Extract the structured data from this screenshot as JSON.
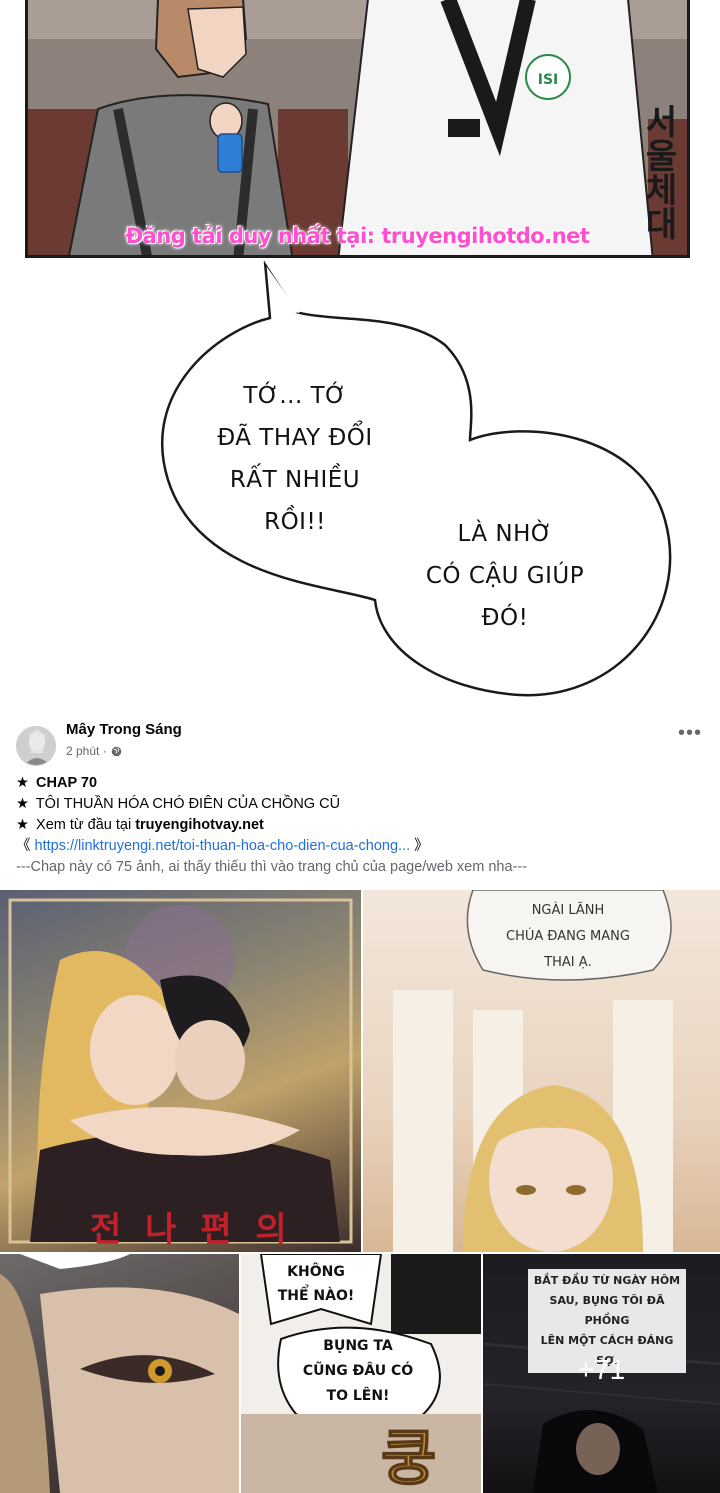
{
  "comic": {
    "watermark": "Đăng tải duy nhất tại: truyengihotdo.net",
    "jacket_text": "서울체대",
    "badge_text": "ISI",
    "bubble1_lines": [
      "TỚ... TỚ",
      "ĐÃ THAY ĐỔI",
      "RẤT NHIỀU",
      "RỒI!!"
    ],
    "bubble2_lines": [
      "LÀ NHỜ",
      "CÓ CẬU GIÚP",
      "ĐÓ!"
    ]
  },
  "post": {
    "author": "Mây Trong Sáng",
    "time": "2 phút ·",
    "more_icon": "ellipsis-icon",
    "lines": {
      "chap": "CHAP 70",
      "title": "TÔI THUẦN HÓA CHÓ ĐIÊN CỦA CHỒNG CŨ",
      "read_from_start": "Xem từ đầu tại ",
      "site": "truyengihotvay.net",
      "link": "https://linktruyengi.net/toi-thuan-hoa-cho-dien-cua-chong...",
      "link_open": "《 ",
      "link_close": " 》",
      "note": "---Chap này có 75 ảnh, ai thấy thiếu thì vào trang chủ của page/web xem nha---"
    },
    "star": "★"
  },
  "grid": {
    "cover_title": "전 나 편 의",
    "tile2_caption": [
      "NGÀI LÃNH",
      "CHÚA ĐANG MANG",
      "THAI Ạ."
    ],
    "tile4_caption_a": [
      "KHÔNG",
      "THỂ NÀO!"
    ],
    "tile4_caption_b": [
      "BỤNG TA",
      "CŨNG ĐÂU CÓ",
      "TO LÊN!"
    ],
    "tile4_sfx": "쿵",
    "tile5_caption": [
      "BẮT ĐẦU TỪ NGÀY HÔM",
      "SAU, BỤNG TÔI ĐÃ PHỒNG",
      "LÊN MỘT CÁCH ĐÁNG SỢ."
    ],
    "more_count": "+71"
  }
}
